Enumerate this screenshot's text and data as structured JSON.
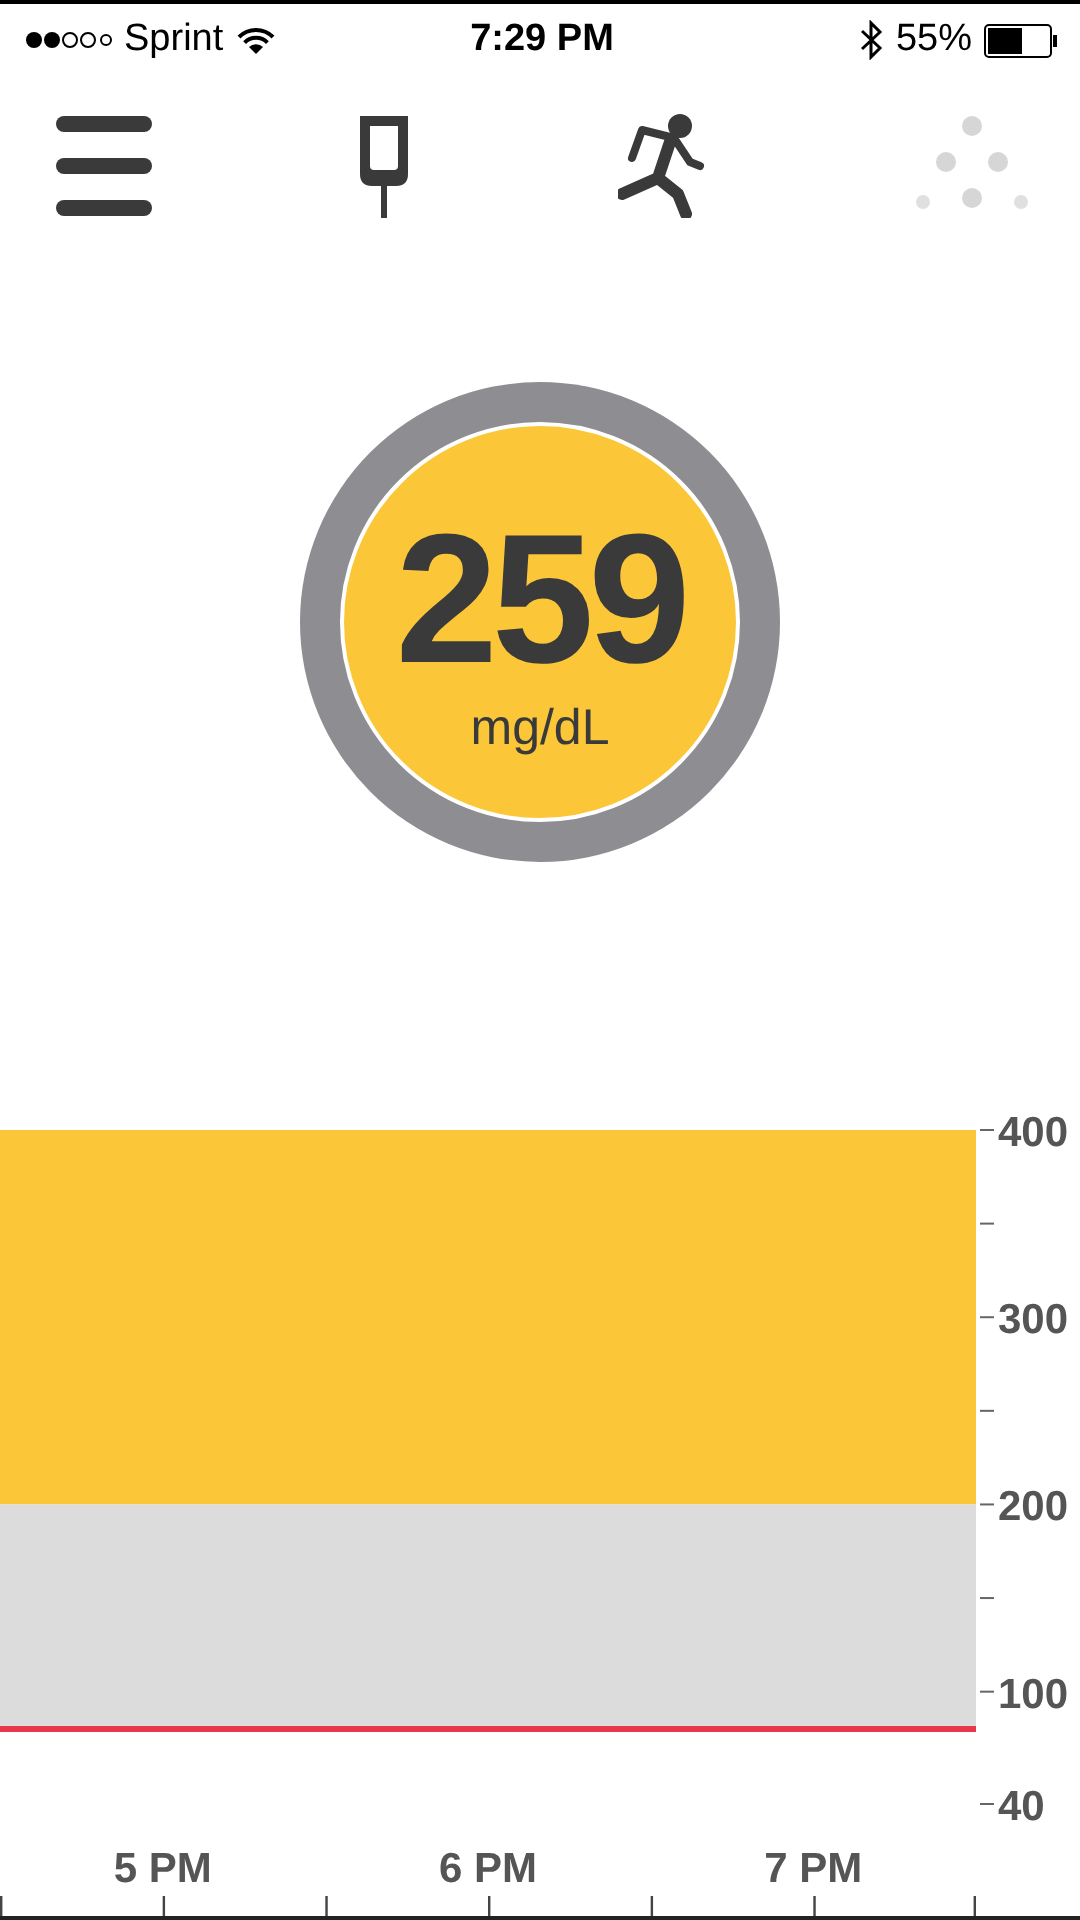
{
  "status_bar": {
    "carrier": "Sprint",
    "time": "7:29 PM",
    "battery": "55%"
  },
  "reading": {
    "value": "259",
    "unit": "mg/dL"
  },
  "chart": {
    "chart_data": {
      "type": "line",
      "categories": [
        "5 PM",
        "6 PM",
        "7 PM"
      ],
      "ylim": [
        40,
        400
      ],
      "yticks": [
        400,
        300,
        200,
        100,
        40
      ],
      "bands": [
        {
          "axis": "y",
          "from": 200,
          "to": 400,
          "color": "#fbc738"
        },
        {
          "axis": "y",
          "from": 80,
          "to": 200,
          "color": "#dcdcdc"
        }
      ],
      "ref_lines": [
        {
          "axis": "y",
          "value": 80,
          "color": "#e8374a"
        }
      ]
    }
  }
}
